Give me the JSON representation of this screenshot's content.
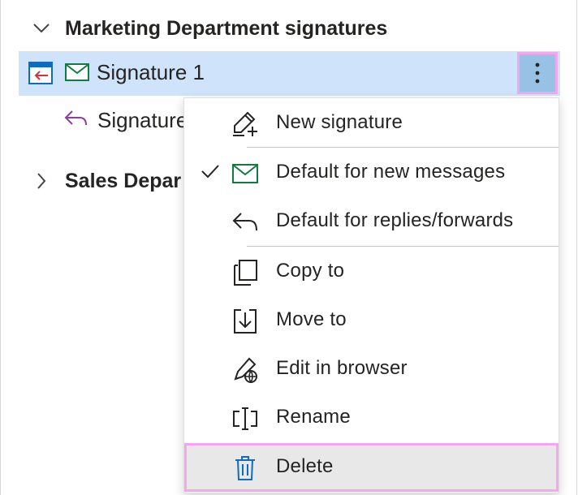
{
  "groups": [
    {
      "label": "Marketing Department signatures",
      "expanded": true
    },
    {
      "label": "Sales Depar",
      "expanded": false
    }
  ],
  "signatures": [
    {
      "name": "Signature 1",
      "selected": true,
      "default_new": true
    },
    {
      "name": "Signature",
      "selected": false,
      "default_reply": true
    }
  ],
  "context_menu": {
    "items": [
      {
        "label": "New signature",
        "icon": "new-signature-icon"
      },
      {
        "label": "Default for new messages",
        "icon": "mail-icon",
        "checked": true
      },
      {
        "label": "Default for replies/forwards",
        "icon": "reply-icon"
      },
      {
        "label": "Copy to",
        "icon": "copy-to-icon"
      },
      {
        "label": "Move to",
        "icon": "move-to-icon"
      },
      {
        "label": "Edit in browser",
        "icon": "edit-in-browser-icon"
      },
      {
        "label": "Rename",
        "icon": "rename-icon"
      },
      {
        "label": "Delete",
        "icon": "trash-icon",
        "highlighted": true
      }
    ]
  },
  "colors": {
    "selection": "#cfe4fa",
    "more_button": "#97c2e5",
    "highlight_border": "#f5a6f0",
    "mail_green": "#107c41",
    "reply_purple": "#8a3fa5",
    "delete_blue": "#0f6cbd"
  }
}
